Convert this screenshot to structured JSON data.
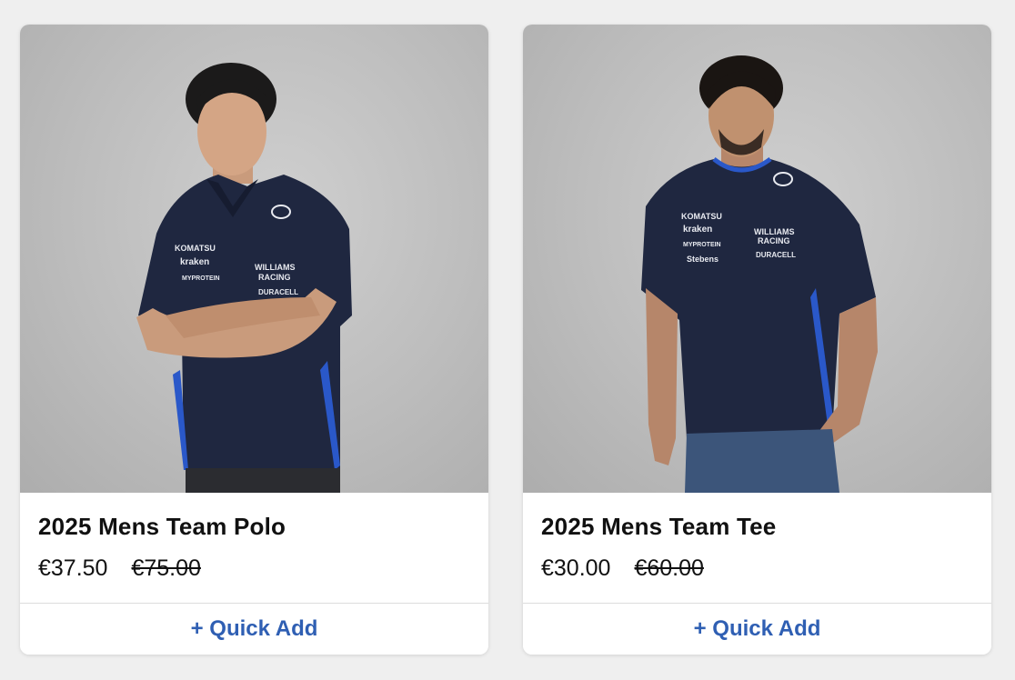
{
  "products": [
    {
      "image_alt": "Driver wearing navy Williams Racing team polo",
      "logo_text": "WILLIAMS RACING",
      "sponsors": [
        "KOMATSU",
        "kraken",
        "MYPROTEIN",
        "DURACELL"
      ],
      "title": "2025 Mens Team Polo",
      "price": "€37.50",
      "original_price": "€75.00",
      "quick_add_label": "+ Quick Add"
    },
    {
      "image_alt": "Driver wearing navy Williams Racing team tee",
      "logo_text": "WILLIAMS RACING",
      "sponsors": [
        "KOMATSU",
        "kraken",
        "MYPROTEIN",
        "Stebens",
        "DURACELL"
      ],
      "title": "2025 Mens Team Tee",
      "price": "€30.00",
      "original_price": "€60.00",
      "quick_add_label": "+ Quick Add"
    }
  ],
  "colors": {
    "page_bg": "#efefef",
    "card_bg": "#ffffff",
    "accent": "#2f5fb3",
    "shirt_navy": "#1f2740",
    "shirt_accent_blue": "#2a58c9"
  }
}
